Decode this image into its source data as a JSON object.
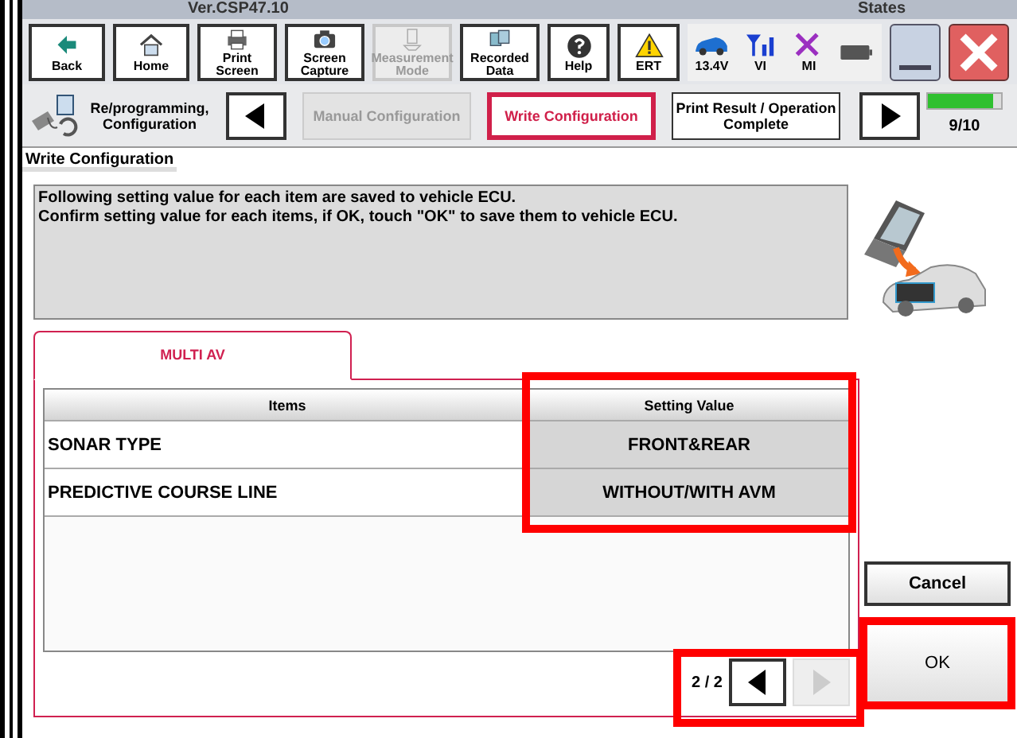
{
  "window": {
    "version": "Ver.CSP47.10",
    "states_label": "States"
  },
  "toolbar": [
    {
      "label": "Back",
      "kind": "back",
      "disabled": false
    },
    {
      "label": "Home",
      "kind": "home",
      "disabled": false
    },
    {
      "label": "Print Screen",
      "kind": "print",
      "disabled": false
    },
    {
      "label": "Screen Capture",
      "kind": "camera",
      "disabled": false
    },
    {
      "label": "Measurement Mode",
      "kind": "measure",
      "disabled": true
    },
    {
      "label": "Recorded Data",
      "kind": "data",
      "disabled": false
    },
    {
      "label": "Help",
      "kind": "help",
      "disabled": false
    },
    {
      "label": "ERT",
      "kind": "warning",
      "disabled": false
    }
  ],
  "status": [
    {
      "label": "13.4V",
      "kind": "car"
    },
    {
      "label": "VI",
      "kind": "signal"
    },
    {
      "label": "MI",
      "kind": "cross"
    },
    {
      "kind": "battery"
    }
  ],
  "steps": {
    "title": "Re/programming, Configuration",
    "items": [
      {
        "label": "Manual Configuration",
        "selected": false,
        "disabled": true
      },
      {
        "label": "Write Configuration",
        "selected": true,
        "disabled": false
      },
      {
        "label": "Print Result / Operation Complete",
        "selected": false,
        "disabled": false
      }
    ],
    "progress": {
      "level": 0.9,
      "reading": "9/10"
    }
  },
  "page_title": "Write Configuration",
  "message": [
    "Following setting value for each item are saved to vehicle ECU.",
    "Confirm setting value for each items, if OK, touch \"OK\" to save them to vehicle ECU."
  ],
  "tabs": [
    {
      "label": "MULTI AV",
      "selected": true
    }
  ],
  "table": {
    "columns": [
      {
        "label": "Items",
        "highlighted": false
      },
      {
        "label": "Setting Value",
        "highlighted": true
      }
    ],
    "rows": [
      [
        "SONAR TYPE",
        "FRONT&REAR"
      ],
      [
        "PREDICTIVE COURSE LINE",
        "WITHOUT/WITH AVM"
      ]
    ]
  },
  "pager": {
    "label": "2 / 2",
    "prev_disabled": false,
    "next_disabled": true,
    "highlighted": true
  },
  "buttons": [
    {
      "label": "Cancel",
      "highlighted": false
    },
    {
      "label": "OK",
      "highlighted": true
    }
  ]
}
